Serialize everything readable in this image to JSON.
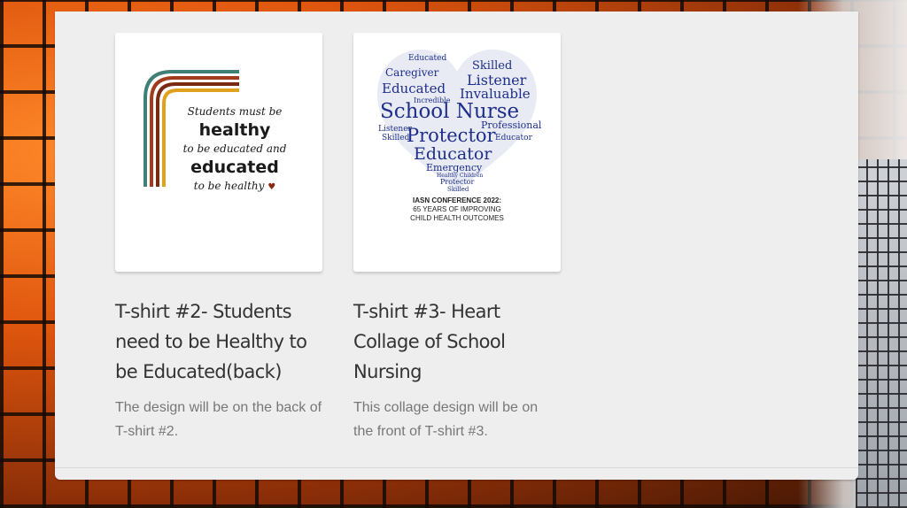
{
  "cards": [
    {
      "title": "T-shirt #2- Students need to be Healthy to be Educated(back)",
      "description": "The design will be on the back of T-shirt #2.",
      "design": {
        "line1": "Students must be",
        "line2": "healthy",
        "line3": "to be educated and",
        "line4": "educated",
        "line5": "to be healthy",
        "arc_colors": [
          "#3f7f74",
          "#a23a1c",
          "#7a2a12",
          "#e0a21e"
        ]
      }
    },
    {
      "title": "T-shirt #3- Heart Collage of School Nursing",
      "description": "This collage design will be on the front of T-shirt #3.",
      "design": {
        "words": [
          "Skilled",
          "Educated",
          "Caregiver",
          "Listener",
          "Educated",
          "Invaluable",
          "Incredible",
          "School Nurse",
          "Professional",
          "Listener",
          "Skilled",
          "Protector",
          "Educator",
          "Educator",
          "Emergency",
          "Healthy Children",
          "Protector",
          "Skilled"
        ],
        "conference_line1": "IASN CONFERENCE 2022:",
        "conference_line2": "65 YEARS OF IMPROVING",
        "conference_line3": "CHILD HEALTH OUTCOMES",
        "word_color": "#1d2f8a"
      }
    }
  ]
}
